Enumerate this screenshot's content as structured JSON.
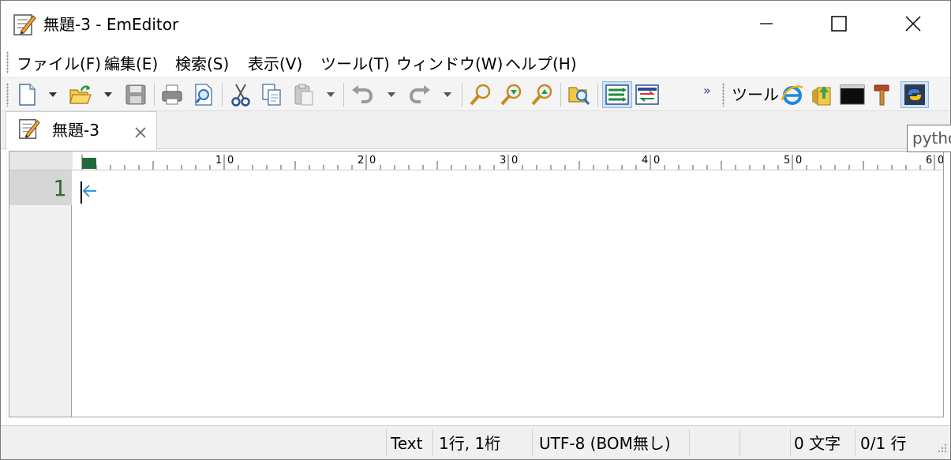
{
  "window": {
    "title": "無題-3 - EmEditor"
  },
  "menubar": {
    "items": [
      {
        "label": "ファイル(F)"
      },
      {
        "label": "編集(E)"
      },
      {
        "label": "検索(S)"
      },
      {
        "label": "表示(V)"
      },
      {
        "label": "ツール(T)"
      },
      {
        "label": "ウィンドウ(W)"
      },
      {
        "label": "ヘルプ(H)"
      }
    ]
  },
  "toolbar": {
    "tools_label": "ツール",
    "overflow_glyph": "»",
    "buttons": [
      "new-file",
      "open-file",
      "save",
      "print",
      "print-preview",
      "cut",
      "copy",
      "paste",
      "undo",
      "redo",
      "find",
      "find-next",
      "find-previous",
      "find-in-files",
      "word-wrap",
      "compare",
      "internet-explorer",
      "file-explorer",
      "command-prompt",
      "build-tool",
      "python"
    ]
  },
  "tabs": [
    {
      "label": "無題-3",
      "active": true
    }
  ],
  "tooltip": {
    "text": "pytho"
  },
  "ruler": {
    "marks": [
      "1",
      "0",
      "2",
      "0",
      "3",
      "0",
      "4",
      "0",
      "5",
      "0",
      "6",
      "0"
    ]
  },
  "editor": {
    "line_numbers": [
      "1"
    ]
  },
  "statusbar": {
    "mode": "Text",
    "position": "1行, 1桁",
    "encoding": "UTF-8 (BOM無し)",
    "chars": "0 文字",
    "lines": "0/1 行"
  },
  "colors": {
    "line_number": "#2f6b35",
    "ruler_marker": "#1f6b3a",
    "active_button": "#cfe2f7",
    "eol_arrow": "#1e88e5"
  }
}
